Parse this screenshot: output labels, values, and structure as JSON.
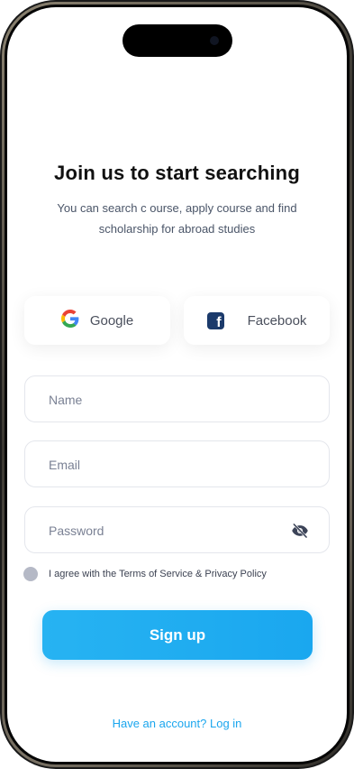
{
  "heading": {
    "title": "Join us to start searching",
    "subtitle": "You can search c ourse, apply course and find scholarship for abroad studies"
  },
  "social": {
    "google_label": "Google",
    "facebook_label": "Facebook"
  },
  "form": {
    "name_placeholder": "Name",
    "email_placeholder": "Email",
    "password_placeholder": "Password",
    "agree_text": "I agree with the Terms of Service & Privacy Policy",
    "agree_checked": false,
    "signup_label": "Sign up"
  },
  "footer": {
    "login_link": "Have an account? Log in"
  },
  "colors": {
    "accent": "#1EA9F0",
    "title": "#111111",
    "muted": "#4A5568"
  },
  "icons": {
    "google": "google-logo-icon",
    "facebook": "facebook-logo-icon",
    "password_toggle": "eye-off-icon"
  }
}
